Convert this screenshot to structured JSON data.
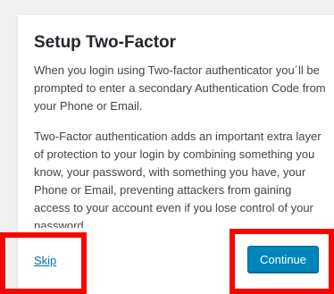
{
  "dialog": {
    "title": "Setup Two-Factor",
    "paragraph1": "When you login using Two-factor authenticator you´ll be prompted to enter a secondary Authentication Code from your Phone or Email.",
    "paragraph2": "Two-Factor authentication adds an important extra layer of protection to your login by combining something you know, your password, with something you have, your Phone or Email, preventing attackers from gaining access to your account even if you lose control of your password.",
    "skip_label": "Skip",
    "continue_label": "Continue"
  },
  "colors": {
    "background": "#f1f1f1",
    "card": "#ffffff",
    "accent": "#0085ba",
    "link": "#0073aa",
    "annotation": "#ff0000"
  }
}
